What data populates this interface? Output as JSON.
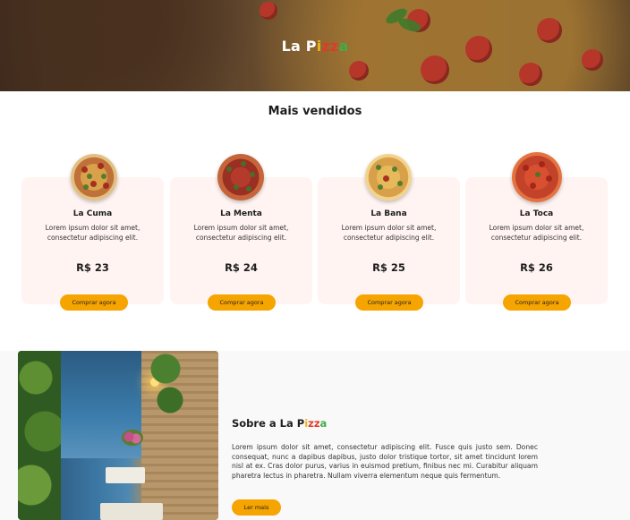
{
  "hero": {
    "brand_prefix": "La ",
    "brand_p": "P",
    "brand_i": "i",
    "brand_zz": "zz",
    "brand_a": "a"
  },
  "bestsellers": {
    "title": "Mais vendidos",
    "buy_label": "Comprar agora",
    "items": [
      {
        "name": "La Cuma",
        "description": "Lorem ipsum dolor sit amet, consectetur adipiscing elit.",
        "price": "R$ 23"
      },
      {
        "name": "La Menta",
        "description": "Lorem ipsum dolor sit amet, consectetur adipiscing elit.",
        "price": "R$ 24"
      },
      {
        "name": "La Bana",
        "description": "Lorem ipsum dolor sit amet, consectetur adipiscing elit.",
        "price": "R$ 25"
      },
      {
        "name": "La Toca",
        "description": "Lorem ipsum dolor sit amet, consectetur adipiscing elit.",
        "price": "R$ 26"
      }
    ]
  },
  "about": {
    "title_prefix": "Sobre a La ",
    "title_p": "P",
    "title_i": "i",
    "title_zz": "zz",
    "title_a": "a",
    "text": "Lorem ipsum dolor sit amet, consectetur adipiscing elit. Fusce quis justo sem. Donec consequat, nunc a dapibus dapibus, justo dolor tristique tortor, sit amet tincidunt lorem nisl at ex. Cras dolor purus, varius in euismod pretium, finibus nec mi. Curabitur aliquam pharetra lectus in pharetra. Nullam viverra elementum neque quis fermentum.",
    "button_label": "Ler mais"
  },
  "colors": {
    "accent": "#f6a400",
    "card_background": "#fff4f2",
    "brand_yellow": "#f0b31a",
    "brand_red": "#e23a2a",
    "brand_green": "#3fae49"
  }
}
